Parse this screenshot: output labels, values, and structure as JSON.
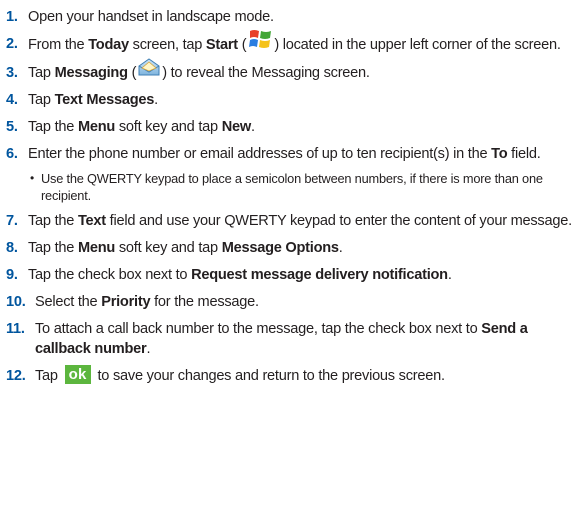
{
  "steps": [
    {
      "num": "1.",
      "parts": [
        "Open your handset in landscape mode."
      ]
    },
    {
      "num": "2.",
      "parts": [
        "From the ",
        "Today",
        " screen, tap ",
        "Start",
        " (",
        ") located in the upper left corner of the screen."
      ]
    },
    {
      "num": "3.",
      "parts": [
        "Tap ",
        "Messaging",
        " (",
        ") to reveal the Messaging screen."
      ]
    },
    {
      "num": "4.",
      "parts": [
        "Tap ",
        "Text Messages",
        "."
      ]
    },
    {
      "num": "5.",
      "parts": [
        "Tap the ",
        "Menu",
        " soft key and tap ",
        "New",
        "."
      ]
    },
    {
      "num": "6.",
      "parts": [
        "Enter the phone number or email addresses of up to ten recipient(s) in the ",
        "To",
        " field."
      ],
      "bullet": "Use the QWERTY keypad to place a semicolon between numbers, if there is more than one recipient."
    },
    {
      "num": "7.",
      "parts": [
        "Tap the ",
        "Text",
        " field and use your QWERTY keypad to enter the content of your message."
      ]
    },
    {
      "num": "8.",
      "parts": [
        "Tap the ",
        "Menu",
        " soft key and tap ",
        "Message Options",
        "."
      ]
    },
    {
      "num": "9.",
      "parts": [
        "Tap the check box next to ",
        "Request message delivery notification",
        "."
      ]
    },
    {
      "num": "10.",
      "parts": [
        "Select the ",
        "Priority",
        " for the message."
      ]
    },
    {
      "num": "11.",
      "parts": [
        "To attach a call back number to the message, tap the check box next to ",
        "Send a callback number",
        "."
      ]
    },
    {
      "num": "12.",
      "parts": [
        "Tap ",
        " to save your changes and return to the previous screen."
      ]
    }
  ],
  "ok_button_label": "ok",
  "icons": {
    "start": "windows-start-icon",
    "messaging": "messaging-envelope-icon"
  }
}
